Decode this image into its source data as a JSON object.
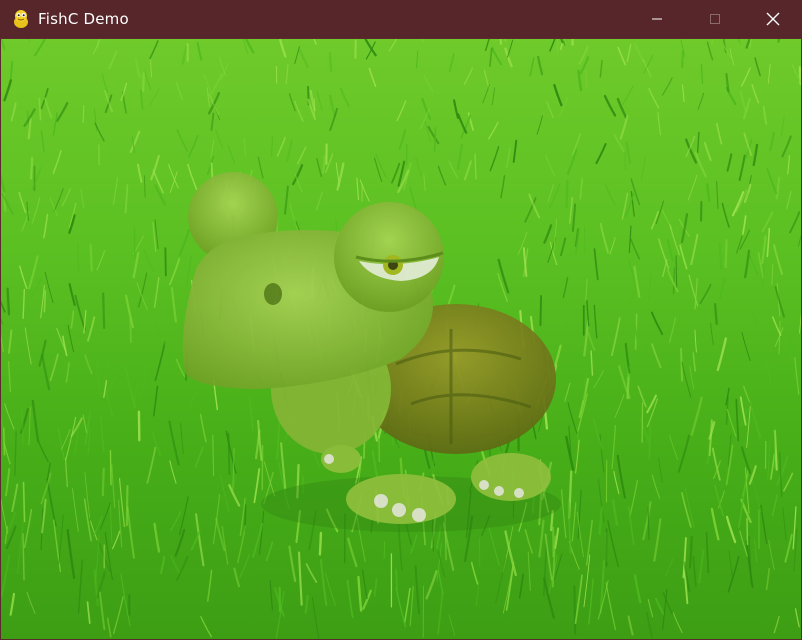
{
  "window": {
    "title": "FishC Demo",
    "icon": "pygame-snake-icon",
    "controls": [
      "minimize-icon",
      "maximize-icon",
      "close-icon"
    ]
  },
  "scene": {
    "background": "grass-image",
    "sprite": "turtle-image"
  },
  "colors": {
    "titlebar": "#56262b",
    "title_text": "#ffffff",
    "grass_light": "#7ed437",
    "grass_mid": "#4fb91f",
    "grass_dark": "#2e8a10",
    "turtle_skin": "#8fbf3c",
    "turtle_shell": "#6f7a1a"
  }
}
